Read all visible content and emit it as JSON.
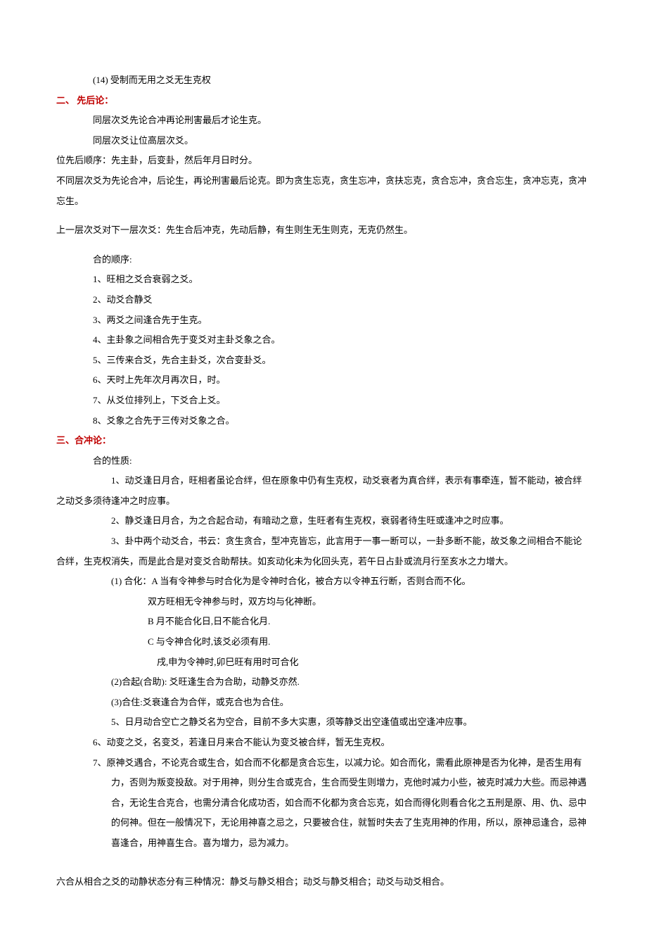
{
  "line1": "(14) 受制而无用之爻无生克权",
  "section2_title": "二、 先后论：",
  "s2_l1": "同层次爻先论合冲再论刑害最后才论生克。",
  "s2_l2": "同层次爻让位高层次爻。",
  "s2_l3": "位先后顺序：先主卦，后变卦，然后年月日时分。",
  "s2_l4": "不同层次爻为先论合冲，后论生，再论刑害最后论克。即为贪生忘克，贪生忘冲，贪扶忘克，贪合忘冲，贪合忘生，贪冲忘克，贪冲忘生。",
  "s2_l5": "上一层次爻对下一层次爻：先生合后冲克，先动后静，有生则生无生则克，无克仍然生。",
  "s2_l6": "合的顺序:",
  "s2_l7": "1、旺相之爻合衰弱之爻。",
  "s2_l8": "2、动爻合静爻",
  "s2_l9": "3、两爻之间逢合先于生克。",
  "s2_l10": "4、主卦象之间相合先于变爻对主卦爻象之合。",
  "s2_l11": "5、三传来合爻，先合主卦爻，次合变卦爻。",
  "s2_l12": "6、天时上先年次月再次日，时。",
  "s2_l13": "7、从爻位排列上，下爻合上爻。",
  "s2_l14": "8、爻象之合先于三传对爻象之合。",
  "section3_title": "三、合冲论：",
  "s3_l1": "合的性质:",
  "s3_l2": "1、动爻逢日月合，旺相者虽论合绊，但在原象中仍有生克权，动爻衰者为真合绊，表示有事牵连，暂不能动，被合绊之动爻多须待逢冲之时应事。",
  "s3_l3": "2、静爻逢日月合，为之合起合动，有暗动之意，生旺者有生克权，衰弱者待生旺或逢冲之时应事。",
  "s3_l4": "3、卦中两个动爻合，书云：贪生贪合，型冲克皆忘，此言用于一事一断可以，一卦多断不能，故爻象之间相合不能论合绊，生克权消失，而是此合是对变爻合助帮扶。如亥动化未为化回头克，若午日占卦或流月行至亥水之力增大。",
  "s3_l5": "(1) 合化：A 当有令神参与时合化为是令神时合化，被合方以令神五行断，否则合而不化。",
  "s3_l6": "双方旺相无令神参与时，双方均与化神断。",
  "s3_l7": "B 月不能合化日,日不能合化月.",
  "s3_l8": "C 与令神合化时,该爻必须有用.",
  "s3_l9": "戌,申为令神时,卯巳旺有用时可合化",
  "s3_l10": "(2)合起(合助): 爻旺逢生合为合助，动静爻亦然.",
  "s3_l11": "(3)合住:爻衰逢合为合伴，或克合也为合住。",
  "s3_l12": "5、日月动合空亡之静爻名为空合，目前不多大实惠，须等静爻出空逢值或出空逢冲应事。",
  "s3_l13": "6、动变之爻，名变爻，若逢日月来合不能认为变爻被合绊，暂无生克权。",
  "s3_l14": "7、原神爻遇合，不论克合或生合，如合而不化都是贪合忘生，以减力论。如合而化，需看此原神是否为化神，是否生用有力，否则为叛变投敌。对于用神，则分生合或克合，生合而受生则增力，克他时减力小些，被克时减力大些。而忌神遇合，无论生合克合，也需分清合化成功否，如合而不化都为贪合忘克，如合而得化则看合化之五刑是原、用、仇、忌中的何神。但在一般情况下，无论用神喜之忌之，只要被合住，就暂时失去了生克用神的作用，所以，原神忌逢合，忌神喜逢合，用神喜生合。喜为增力，忌为减力。",
  "s3_l15": "六合从相合之爻的动静状态分有三种情况：静爻与静爻相合；动爻与静爻相合；动爻与动爻相合。"
}
